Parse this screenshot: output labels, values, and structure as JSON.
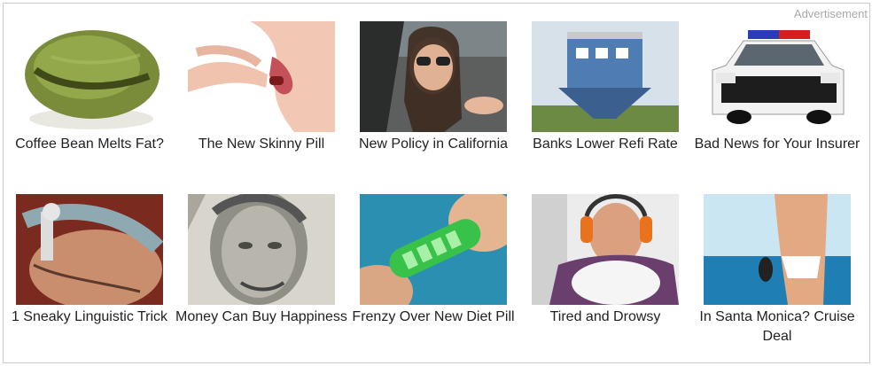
{
  "ad_label": "Advertisement",
  "tiles": [
    {
      "caption": "Coffee Bean Melts Fat?",
      "icon": "coffee-bean-image"
    },
    {
      "caption": "The New Skinny Pill",
      "icon": "pill-lips-image"
    },
    {
      "caption": "New Policy in California",
      "icon": "woman-in-car-image"
    },
    {
      "caption": "Banks Lower Refi Rate",
      "icon": "upside-down-house-image"
    },
    {
      "caption": "Bad News for Your Insurer",
      "icon": "police-car-image"
    },
    {
      "caption": "1 Sneaky Linguistic Trick",
      "icon": "man-with-nasal-device-image"
    },
    {
      "caption": "Money Can Buy Happiness",
      "icon": "lincoln-banknote-image"
    },
    {
      "caption": "Frenzy Over New Diet Pill",
      "icon": "green-capsule-image"
    },
    {
      "caption": "Tired and Drowsy",
      "icon": "man-with-earmuffs-image"
    },
    {
      "caption": "In Santa Monica? Cruise Deal",
      "icon": "beach-bikini-image"
    }
  ],
  "colors": {
    "border": "#c9c9c9",
    "label": "#a9a9a9",
    "caption": "#222222"
  }
}
